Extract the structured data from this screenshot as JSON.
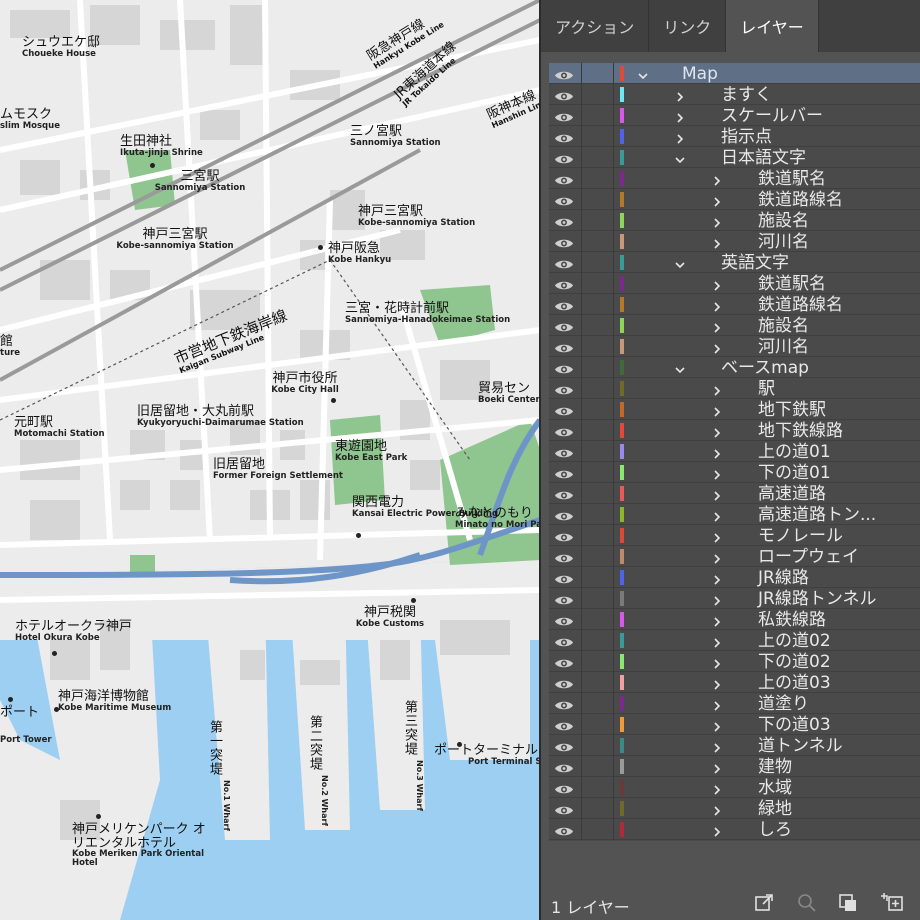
{
  "colors": {
    "water": "#9ccff2",
    "park": "#8fc58f",
    "road": "#ffffff",
    "highway": "#6e95c8",
    "block": "#d9d9d9",
    "panel_bg": "#535353",
    "selected_row": "#5e6f86"
  },
  "map": {
    "labels": [
      {
        "ja": "シュウエケ邸",
        "en": "Choueke House"
      },
      {
        "ja": "ムモスク",
        "en": "slim Mosque"
      },
      {
        "ja": "生田神社",
        "en": "Ikuta-jinja Shrine"
      },
      {
        "ja": "三宮駅",
        "en": "Sannomiya Station"
      },
      {
        "ja": "神戸三宮駅",
        "en": "Kobe-sannomiya Station"
      },
      {
        "ja": "三ノ宮駅",
        "en": "Sannomiya Station"
      },
      {
        "ja": "神戸三宮駅",
        "en": "Kobe-sannomiya Station"
      },
      {
        "ja": "神戸阪急",
        "en": "Kobe Hankyu"
      },
      {
        "ja": "三宮・花時計前駅",
        "en": "Sannomiya-Hanadokeimae Station"
      },
      {
        "ja": "館",
        "en": "ture"
      },
      {
        "ja": "神戸市役所",
        "en": "Kobe City Hall"
      },
      {
        "ja": "貿易セン",
        "en": "Boeki Center"
      },
      {
        "ja": "元町駅",
        "en": "Motomachi Station"
      },
      {
        "ja": "旧居留地・大丸前駅",
        "en": "Kyukyoryuchi-Daimarumae Station"
      },
      {
        "ja": "東遊園地",
        "en": "Kobe East Park"
      },
      {
        "ja": "旧居留地",
        "en": "Former Foreign Settlement"
      },
      {
        "ja": "関西電力",
        "en": "Kansai Electric Power Building"
      },
      {
        "ja": "みなとのもり",
        "en": "Minato no Mori Par"
      },
      {
        "ja": "神戸税関",
        "en": "Kobe Customs"
      },
      {
        "ja": "ホテルオークラ神戸",
        "en": "Hotel Okura Kobe"
      },
      {
        "ja": "神戸海洋博物館",
        "en": "Kobe Maritime Museum"
      },
      {
        "ja": "ポート",
        "en": "Port Tower"
      },
      {
        "ja": "ポートターミナル",
        "en": "Port Terminal S"
      },
      {
        "ja": "神戸メリケンパーク オリエンタルホテル",
        "en": "Kobe Meriken Park Oriental Hotel"
      }
    ],
    "rail_labels": [
      {
        "ja": "阪急神戸線",
        "en": "Hankyu Kobe Line"
      },
      {
        "ja": "JR東海道本線",
        "en": "JR Tokaido Line"
      },
      {
        "ja": "阪神本線",
        "en": "Hanshin Line"
      },
      {
        "ja": "市営地下鉄海岸線",
        "en": "Kaigan Subway Line"
      }
    ],
    "wharves": [
      {
        "ja": "第一突堤",
        "en": "No.1 Wharf"
      },
      {
        "ja": "第二突堤",
        "en": "No.2 Wharf"
      },
      {
        "ja": "第三突堤",
        "en": "No.3 Wharf"
      }
    ]
  },
  "panel": {
    "tabs": [
      {
        "label": "アクション"
      },
      {
        "label": "リンク"
      },
      {
        "label": "レイヤー"
      }
    ],
    "active_tab": 2,
    "layers": [
      {
        "name": "Map",
        "level": 0,
        "expanded": true,
        "color": "#e04a3a",
        "selected": true
      },
      {
        "name": "ますく",
        "level": 1,
        "expanded": false,
        "color": "#6fe7f2"
      },
      {
        "name": "スケールバー",
        "level": 1,
        "expanded": false,
        "color": "#d65ae6"
      },
      {
        "name": "指示点",
        "level": 1,
        "expanded": false,
        "color": "#4f62e8"
      },
      {
        "name": "日本語文字",
        "level": 1,
        "expanded": true,
        "color": "#3a9a98"
      },
      {
        "name": "鉄道駅名",
        "level": 2,
        "expanded": false,
        "color": "#7a2a8a"
      },
      {
        "name": "鉄道路線名",
        "level": 2,
        "expanded": false,
        "color": "#b07a2a"
      },
      {
        "name": "施設名",
        "level": 2,
        "expanded": false,
        "color": "#8ed65a"
      },
      {
        "name": "河川名",
        "level": 2,
        "expanded": false,
        "color": "#c8987a"
      },
      {
        "name": "英語文字",
        "level": 1,
        "expanded": true,
        "color": "#3a9a98"
      },
      {
        "name": "鉄道駅名",
        "level": 2,
        "expanded": false,
        "color": "#7a2a8a"
      },
      {
        "name": "鉄道路線名",
        "level": 2,
        "expanded": false,
        "color": "#b07a2a"
      },
      {
        "name": "施設名",
        "level": 2,
        "expanded": false,
        "color": "#8ed65a"
      },
      {
        "name": "河川名",
        "level": 2,
        "expanded": false,
        "color": "#c8987a"
      },
      {
        "name": "ベースmap",
        "level": 1,
        "expanded": true,
        "color": "#3f6a3a"
      },
      {
        "name": "駅",
        "level": 2,
        "expanded": false,
        "color": "#6e6a2a"
      },
      {
        "name": "地下鉄駅",
        "level": 2,
        "expanded": false,
        "color": "#c06a2a"
      },
      {
        "name": "地下鉄線路",
        "level": 2,
        "expanded": false,
        "color": "#e04a3a"
      },
      {
        "name": "上の道01",
        "level": 2,
        "expanded": false,
        "color": "#9a8ae8"
      },
      {
        "name": "下の道01",
        "level": 2,
        "expanded": false,
        "color": "#8ae872"
      },
      {
        "name": "高速道路",
        "level": 2,
        "expanded": false,
        "color": "#e85a5a"
      },
      {
        "name": "高速道路トン...",
        "level": 2,
        "expanded": false,
        "color": "#8ab82a"
      },
      {
        "name": "モノレール",
        "level": 2,
        "expanded": false,
        "color": "#d84a3a"
      },
      {
        "name": "ロープウェイ",
        "level": 2,
        "expanded": false,
        "color": "#c08a6a"
      },
      {
        "name": "JR線路",
        "level": 2,
        "expanded": false,
        "color": "#4f62e8"
      },
      {
        "name": "JR線路トンネル",
        "level": 2,
        "expanded": false,
        "color": "#7a7a7a"
      },
      {
        "name": "私鉄線路",
        "level": 2,
        "expanded": false,
        "color": "#d65ae6"
      },
      {
        "name": "上の道02",
        "level": 2,
        "expanded": false,
        "color": "#3a9a98"
      },
      {
        "name": "下の道02",
        "level": 2,
        "expanded": false,
        "color": "#8ae872"
      },
      {
        "name": "上の道03",
        "level": 2,
        "expanded": false,
        "color": "#f0a0a0"
      },
      {
        "name": "道塗り",
        "level": 2,
        "expanded": false,
        "color": "#7a2a8a"
      },
      {
        "name": "下の道03",
        "level": 2,
        "expanded": false,
        "color": "#f09a3a"
      },
      {
        "name": "道トンネル",
        "level": 2,
        "expanded": false,
        "color": "#3a8a88"
      },
      {
        "name": "建物",
        "level": 2,
        "expanded": false,
        "color": "#9a9a9a"
      },
      {
        "name": "水域",
        "level": 2,
        "expanded": false,
        "color": "#6a3a3a"
      },
      {
        "name": "緑地",
        "level": 2,
        "expanded": false,
        "color": "#6e6a2a"
      },
      {
        "name": "しろ",
        "level": 2,
        "expanded": false,
        "color": "#b02a3a"
      }
    ],
    "footer": {
      "layer_count": "1 レイヤー",
      "icons": [
        "export-icon",
        "search-icon",
        "clip-mask-icon",
        "new-sublayer-icon"
      ]
    }
  }
}
